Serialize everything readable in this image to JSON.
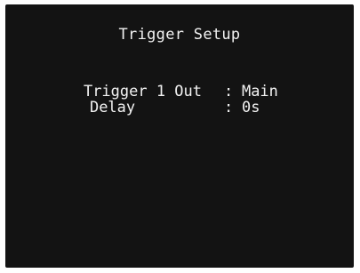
{
  "screen": {
    "title": "Trigger Setup",
    "rows": [
      {
        "label": "Trigger 1 Out",
        "separator": ":",
        "value": "Main"
      },
      {
        "label": "Delay",
        "separator": ":",
        "value": "0s"
      }
    ],
    "colors": {
      "background": "#131313",
      "text": "#f2f2f2"
    }
  }
}
